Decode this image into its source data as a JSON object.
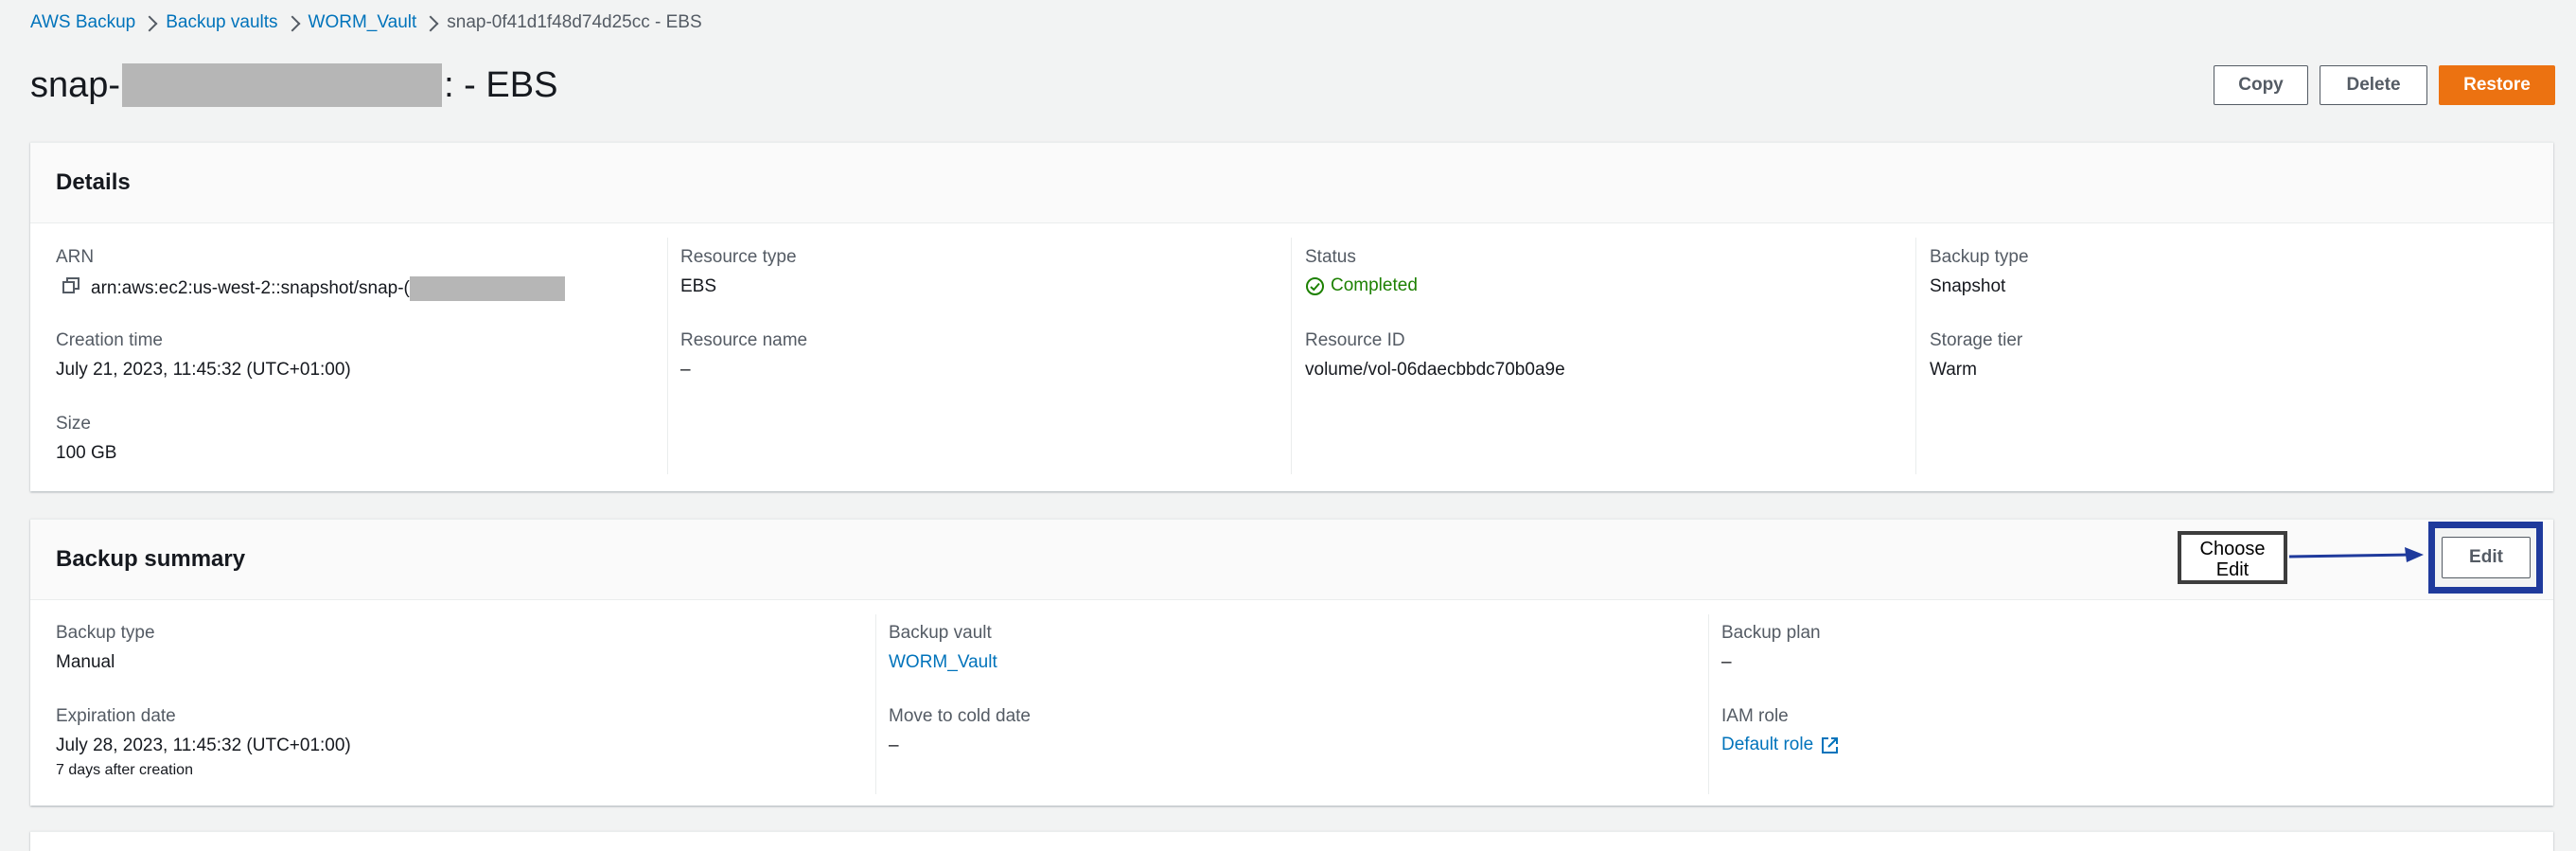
{
  "breadcrumb": {
    "aws_backup": "AWS Backup",
    "backup_vaults": "Backup vaults",
    "vault": "WORM_Vault",
    "current": "snap-0f41d1f48d74d25cc - EBS"
  },
  "title": {
    "prefix": "snap-",
    "suffix": ": - EBS"
  },
  "actions": {
    "copy": "Copy",
    "delete": "Delete",
    "restore": "Restore"
  },
  "details": {
    "heading": "Details",
    "arn": {
      "label": "ARN",
      "value": "arn:aws:ec2:us-west-2::snapshot/snap-("
    },
    "creation_time": {
      "label": "Creation time",
      "value": "July 21, 2023, 11:45:32 (UTC+01:00)"
    },
    "size": {
      "label": "Size",
      "value": "100 GB"
    },
    "resource_type": {
      "label": "Resource type",
      "value": "EBS"
    },
    "resource_name": {
      "label": "Resource name",
      "value": "–"
    },
    "status": {
      "label": "Status",
      "value": "Completed"
    },
    "resource_id": {
      "label": "Resource ID",
      "value": "volume/vol-06daecbbdc70b0a9e"
    },
    "backup_type": {
      "label": "Backup type",
      "value": "Snapshot"
    },
    "storage_tier": {
      "label": "Storage tier",
      "value": "Warm"
    }
  },
  "summary": {
    "heading": "Backup summary",
    "edit": "Edit",
    "backup_type": {
      "label": "Backup type",
      "value": "Manual"
    },
    "expiration_date": {
      "label": "Expiration date",
      "value": "July 28, 2023, 11:45:32 (UTC+01:00)",
      "note": "7 days after creation"
    },
    "backup_vault": {
      "label": "Backup vault",
      "value": "WORM_Vault"
    },
    "cold_date": {
      "label": "Move to cold date",
      "value": "–"
    },
    "backup_plan": {
      "label": "Backup plan",
      "value": "–"
    },
    "iam_role": {
      "label": "IAM role",
      "value": "Default role"
    }
  },
  "annotation": {
    "line1": "Choose",
    "line2": "Edit"
  },
  "colors": {
    "link": "#0073bb",
    "primary": "#ec7211",
    "success": "#1d8102",
    "highlight": "#1f3a9c"
  },
  "icons": [
    "chevron-right-icon",
    "copy-icon",
    "check-circle-icon",
    "external-link-icon"
  ]
}
